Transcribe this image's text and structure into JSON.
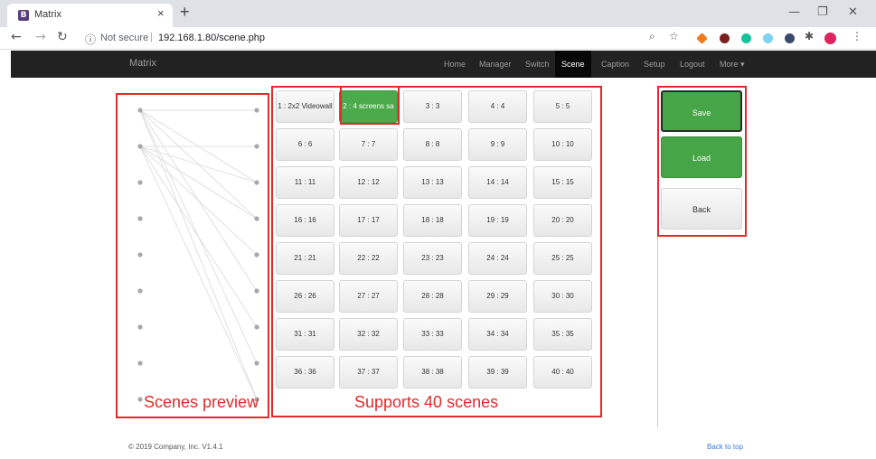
{
  "browser": {
    "tab_title": "Matrix",
    "tab_favicon_letter": "B",
    "new_tab_symbol": "+",
    "close_symbol": "×",
    "url_secure_label": "Not secure",
    "url": "192.168.1.80/scene.php"
  },
  "navbar": {
    "brand": "Matrix",
    "items": [
      {
        "label": "Home"
      },
      {
        "label": "Manager"
      },
      {
        "label": "Switch"
      },
      {
        "label": "Scene"
      },
      {
        "label": "Caption"
      },
      {
        "label": "Setup"
      },
      {
        "label": "Logout"
      },
      {
        "label": "More ▾"
      }
    ],
    "active_item": "Scene"
  },
  "scenes": [
    "1 : 2x2 Videowall",
    "2 : 4 screens sa",
    "3 : 3",
    "4 : 4",
    "5 : 5",
    "6 : 6",
    "7 : 7",
    "8 : 8",
    "9 : 9",
    "10 : 10",
    "11 : 11",
    "12 : 12",
    "13 : 13",
    "14 : 14",
    "15 : 15",
    "16 : 16",
    "17 : 17",
    "18 : 18",
    "19 : 19",
    "20 : 20",
    "21 : 21",
    "22 : 22",
    "23 : 23",
    "24 : 24",
    "25 : 25",
    "26 : 26",
    "27 : 27",
    "28 : 28",
    "29 : 29",
    "30 : 30",
    "31 : 31",
    "32 : 32",
    "33 : 33",
    "34 : 34",
    "35 : 35",
    "36 : 36",
    "37 : 37",
    "38 : 38",
    "39 : 39",
    "40 : 40"
  ],
  "selected_scene_index": 1,
  "actions": {
    "save": "Save",
    "load": "Load",
    "back": "Back"
  },
  "annotations": {
    "preview_label": "Scenes preview",
    "grid_label": "Supports 40 scenes"
  },
  "footer": {
    "copyright": "© 2019 Company, Inc. V1.4.1",
    "back_to_top": "Back to top"
  },
  "colors": {
    "annotation_red": "#e02b2b",
    "selected_green": "#4caa4c",
    "navbar_bg": "#222222"
  }
}
